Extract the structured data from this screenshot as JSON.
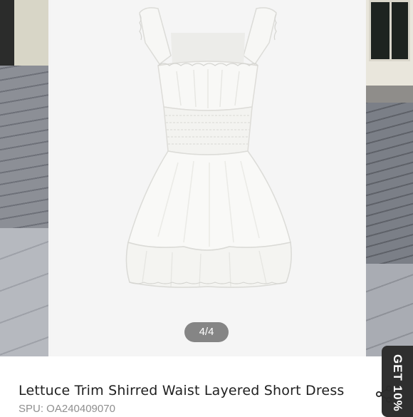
{
  "gallery": {
    "counter": "4/4",
    "current_slide": 4,
    "total_slides": 4
  },
  "product": {
    "title": "Lettuce Trim Shirred Waist Layered Short Dress",
    "spu": "SPU: OA240409070"
  },
  "promo": {
    "label": "GET 10%"
  },
  "icons": {
    "share": "share-icon"
  },
  "colors": {
    "promo_bg": "#2f2f2f",
    "counter_bg": "#5a5a5a",
    "title": "#1f1f1f",
    "spu": "#8f8f8f"
  }
}
